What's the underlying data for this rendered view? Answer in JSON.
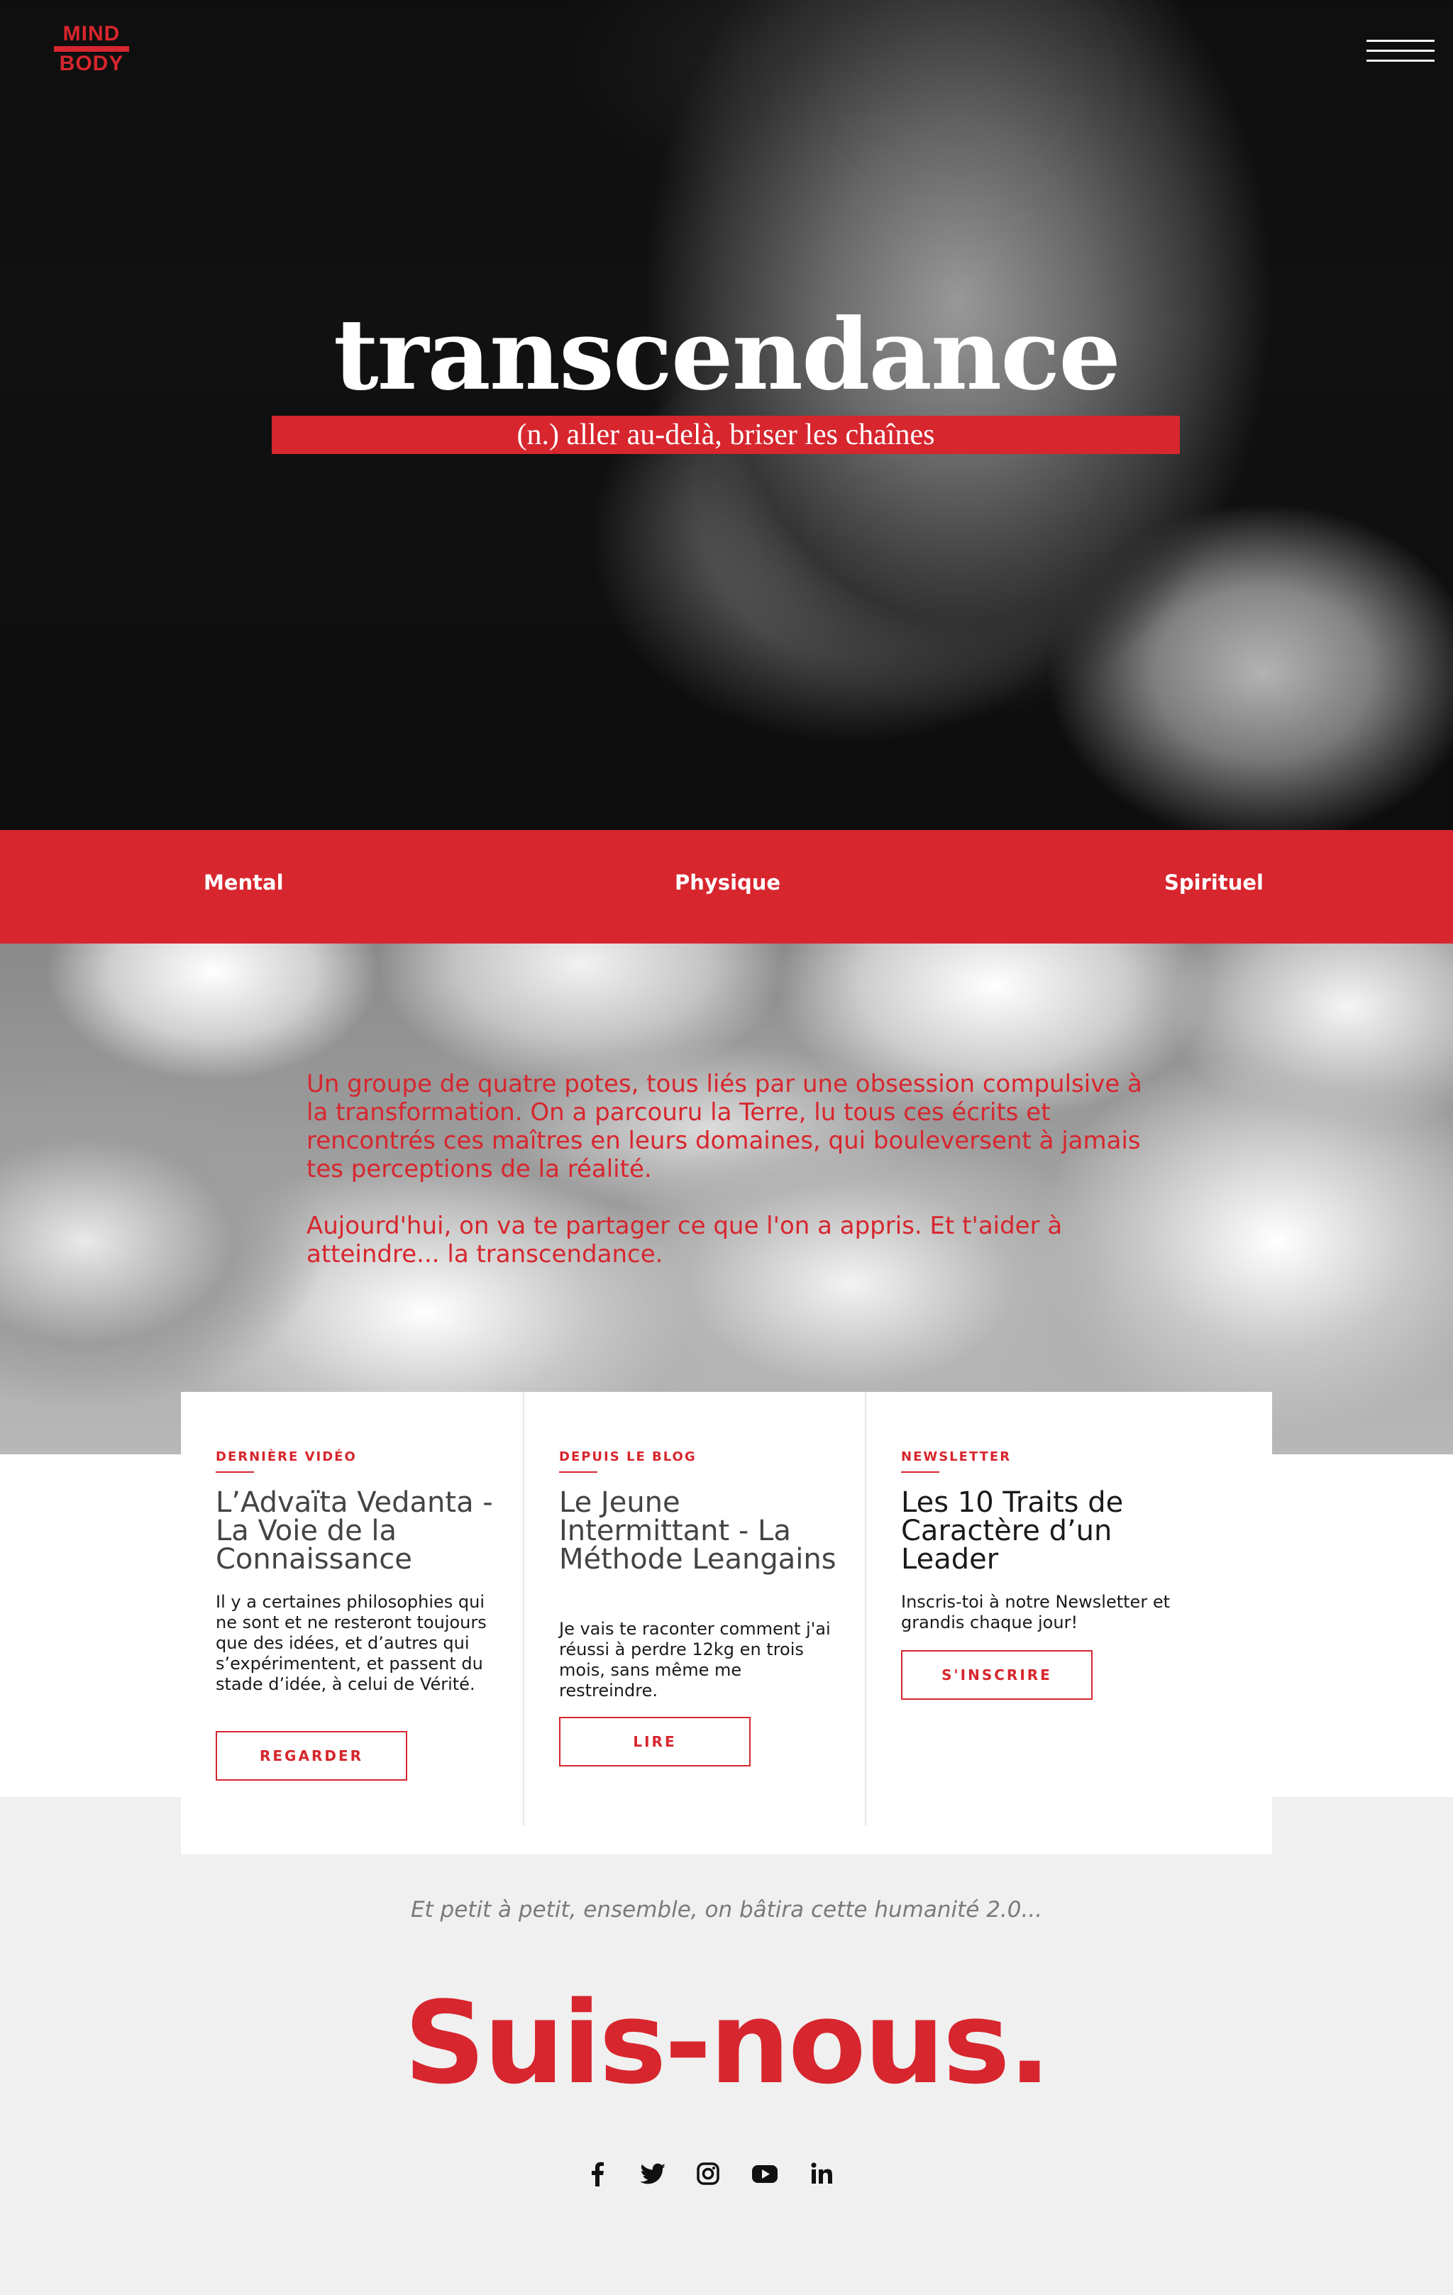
{
  "header": {
    "logo_top": "MIND",
    "logo_bottom": "BODY",
    "menu_icon": "hamburger-icon"
  },
  "hero": {
    "title": "transcendance",
    "subtitle": "(n.) aller au-delà, briser les chaînes"
  },
  "pillars": [
    "Mental",
    "Physique",
    "Spirituel"
  ],
  "intro": {
    "paragraph1": "Un groupe de quatre potes, tous liés par une obsession compulsive à la transformation. On a parcouru la Terre, lu tous ces écrits et rencontrés ces maîtres en leurs domaines, qui bouleversent à jamais tes perceptions de la réalité.",
    "paragraph2": "Aujourd'hui, on va te partager ce que l'on a appris. Et t'aider à atteindre... la transcendance."
  },
  "cards": [
    {
      "kicker": "DERNIÈRE VIDÉO",
      "title": "L’Advaïta Vedanta - La Voie de la Connaissance",
      "description": "Il y a certaines philosophies qui ne sont et ne resteront toujours que des idées, et d’autres qui s’expérimentent, et passent du stade d’idée, à celui de Vérité.",
      "button": "REGARDER"
    },
    {
      "kicker": "DEPUIS LE BLOG",
      "title": "Le Jeune Intermittant - La Méthode Leangains",
      "description": "Je vais te raconter comment j'ai réussi à perdre 12kg en trois mois, sans même me restreindre.",
      "button": "LIRE"
    },
    {
      "kicker": "NEWSLETTER",
      "title": "Les 10 Traits de Caractère d’un Leader",
      "description": "Inscris-toi à notre Newsletter et grandis chaque jour!",
      "button": "S'INSCRIRE"
    }
  ],
  "follow": {
    "tagline": "Et petit à petit, ensemble, on bâtira cette humanité 2.0...",
    "heading": "Suis-nous.",
    "socials": [
      "facebook-icon",
      "twitter-icon",
      "instagram-icon",
      "youtube-icon",
      "linkedin-icon"
    ]
  },
  "colors": {
    "accent": "#d7262e",
    "background": "#f0f0f0",
    "card_bg": "#ffffff",
    "icon": "#111111"
  }
}
